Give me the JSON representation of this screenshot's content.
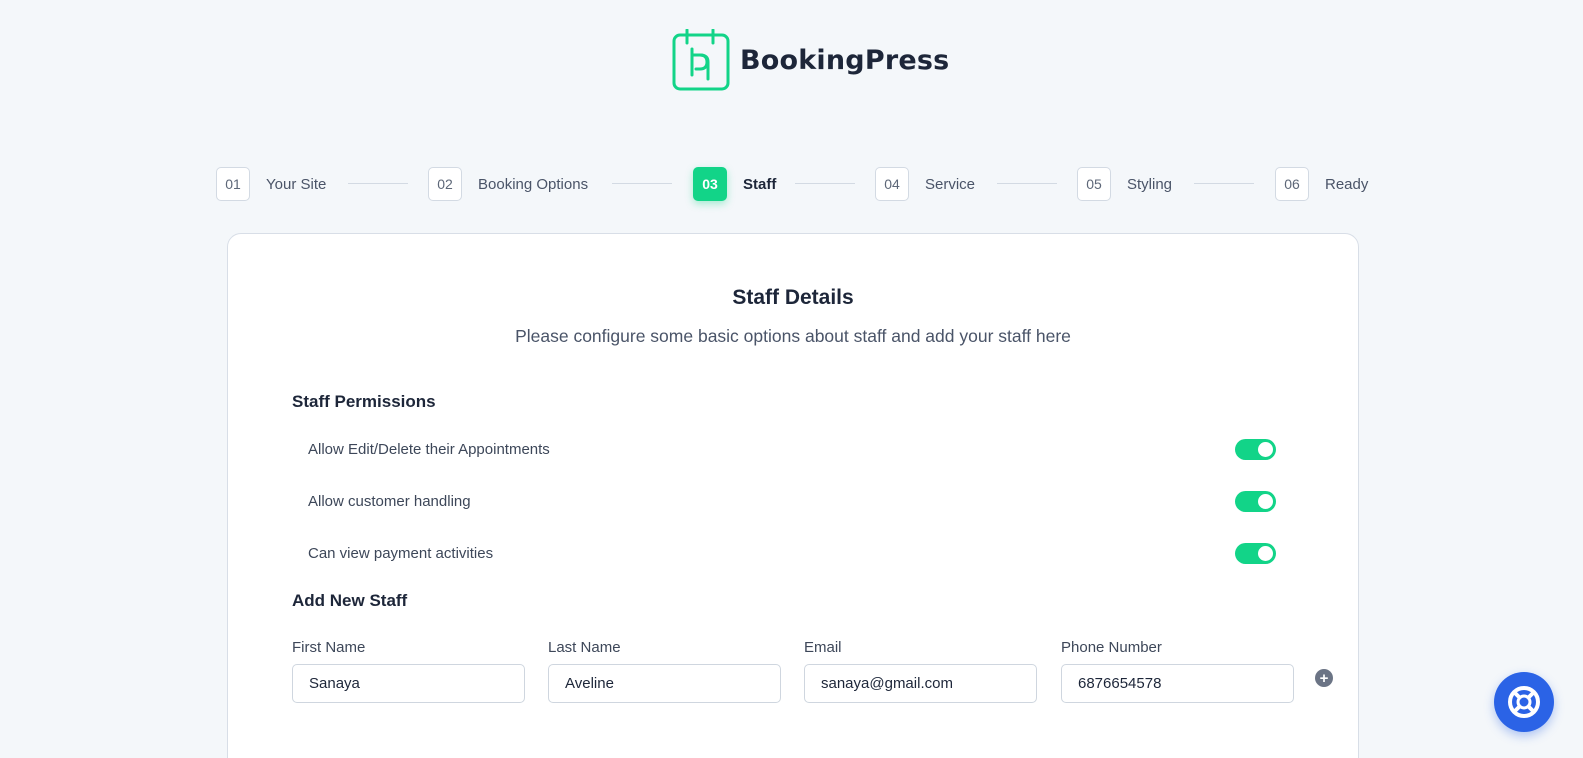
{
  "brand": {
    "name": "BookingPress",
    "accent": "#12d488",
    "fab_color": "#2b63e6"
  },
  "steps": [
    {
      "num": "01",
      "label": "Your Site"
    },
    {
      "num": "02",
      "label": "Booking Options"
    },
    {
      "num": "03",
      "label": "Staff",
      "active": true
    },
    {
      "num": "04",
      "label": "Service"
    },
    {
      "num": "05",
      "label": "Styling"
    },
    {
      "num": "06",
      "label": "Ready"
    }
  ],
  "card": {
    "title": "Staff Details",
    "subtitle": "Please configure some basic options about staff and add your staff here"
  },
  "permissions": {
    "title": "Staff Permissions",
    "items": [
      {
        "label": "Allow Edit/Delete their Appointments",
        "enabled": true
      },
      {
        "label": "Allow customer handling",
        "enabled": true
      },
      {
        "label": "Can view payment activities",
        "enabled": true
      }
    ]
  },
  "add_staff": {
    "title": "Add New Staff",
    "fields": [
      {
        "label": "First Name",
        "value": "Sanaya"
      },
      {
        "label": "Last Name",
        "value": "Aveline"
      },
      {
        "label": "Email",
        "value": "sanaya@gmail.com"
      },
      {
        "label": "Phone Number",
        "value": "6876654578"
      }
    ],
    "add_icon": "plus-circle-icon"
  },
  "help": {
    "icon": "lifebuoy-icon"
  }
}
